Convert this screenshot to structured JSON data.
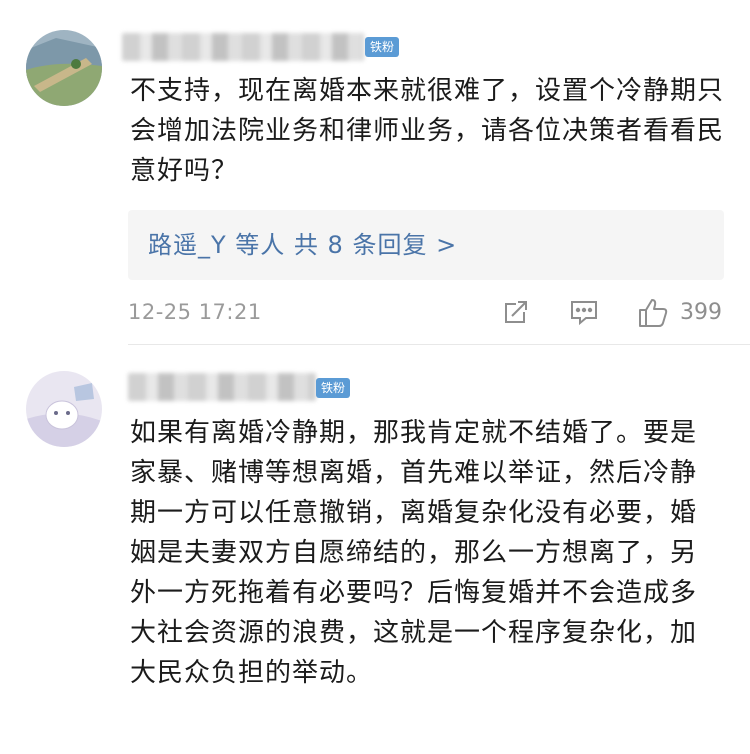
{
  "comments": [
    {
      "badge": "铁粉",
      "text": "不支持，现在离婚本来就很难了，设置个冷静期只会增加法院业务和律师业务，请各位决策者看看民意好吗？",
      "replies_label": "路遥_Y 等人  共 8 条回复 >",
      "time": "12-25 17:21",
      "likes": "399",
      "icons": [
        "share-icon",
        "comment-icon",
        "like-icon"
      ]
    },
    {
      "badge": "铁粉",
      "text": "如果有离婚冷静期，那我肯定就不结婚了。要是家暴、赌博等想离婚，首先难以举证，然后冷静期一方可以任意撤销，离婚复杂化没有必要，婚姻是夫妻双方自愿缔结的，那么一方想离了，另外一方死拖着有必要吗？后悔复婚并不会造成多大社会资源的浪费，这就是一个程序复杂化，加大民众负担的举动。"
    }
  ],
  "colors": {
    "badge": "#5b9bd5",
    "reply_link": "#4a74a8",
    "reply_bg": "#f5f5f5",
    "meta": "#9a9a9a"
  }
}
